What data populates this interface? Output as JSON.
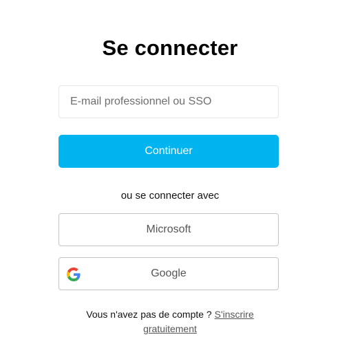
{
  "header": {
    "title": "Se connecter"
  },
  "email": {
    "placeholder": "E-mail professionnel ou SSO",
    "value": ""
  },
  "continue": {
    "label": "Continuer",
    "color": "#00b4f0"
  },
  "divider": {
    "text": "ou se connecter avec"
  },
  "sso": {
    "microsoft": {
      "label": "Microsoft",
      "icon": "microsoft-logo-icon",
      "colors": [
        "#f25022",
        "#7fba00",
        "#00a4ef",
        "#ffb900"
      ]
    },
    "google": {
      "label": "Google",
      "icon": "google-logo-icon"
    }
  },
  "signup": {
    "prompt": "Vous n'avez pas de compte ? ",
    "link": "S'inscrire gratuitement"
  }
}
